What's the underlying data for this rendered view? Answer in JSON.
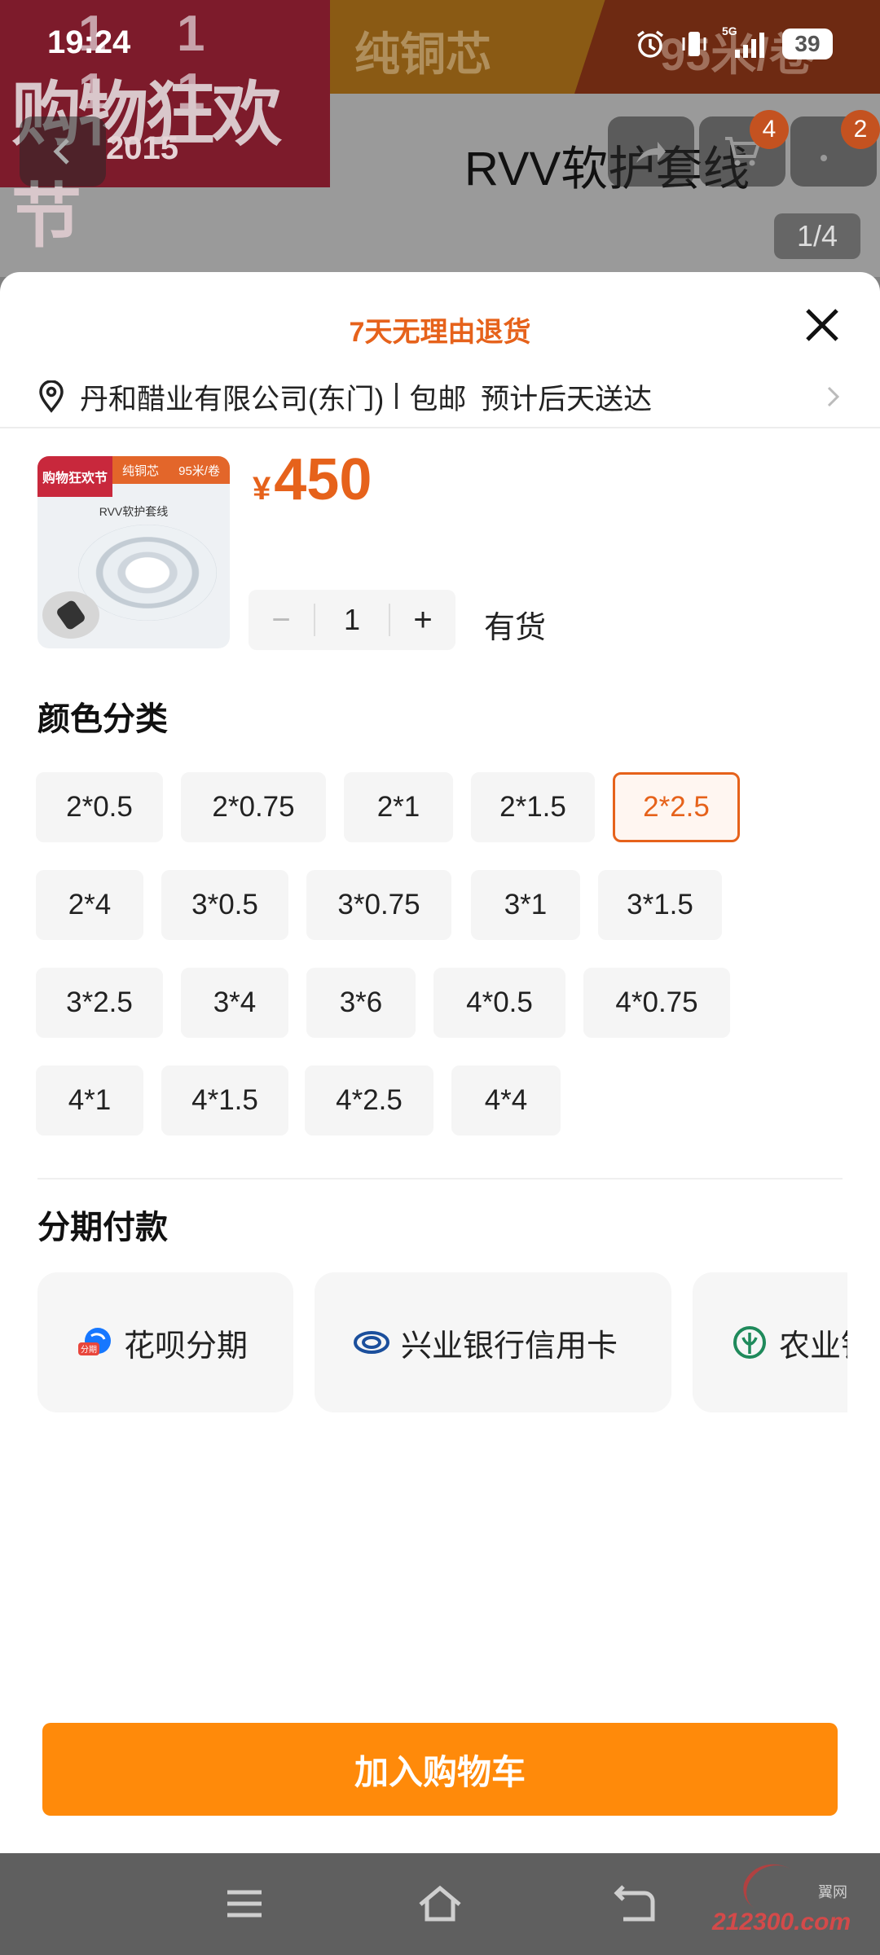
{
  "status_bar": {
    "time": "19:24",
    "network": "5G",
    "battery": "39"
  },
  "background_page": {
    "banner": {
      "festival_top": "11 11",
      "festival_name": "购物狂欢节",
      "festival_year": "2015",
      "copper_core": "纯铜芯",
      "spec": "95米/卷"
    },
    "title": "RVV软护套线",
    "cart_badge": "4",
    "message_badge": "2",
    "page_indicator": "1/4"
  },
  "sheet": {
    "return_policy": "7天无理由退货",
    "address": {
      "location": "丹和醋业有限公司(东门)",
      "shipping": "包邮",
      "delivery": "预计后天送达"
    },
    "product": {
      "thumb_festival": "购物狂欢节",
      "thumb_copper": "纯铜芯",
      "thumb_spec": "95米/卷",
      "thumb_label": "RVV软护套线",
      "currency": "¥",
      "price": "450",
      "quantity": "1",
      "minus": "−",
      "plus": "+",
      "stock": "有货"
    },
    "color_section": {
      "title": "颜色分类",
      "selected": "2*2.5",
      "options": [
        "2*0.5",
        "2*0.75",
        "2*1",
        "2*1.5",
        "2*2.5",
        "2*4",
        "3*0.5",
        "3*0.75",
        "3*1",
        "3*1.5",
        "3*2.5",
        "3*4",
        "3*6",
        "4*0.5",
        "4*0.75",
        "4*1",
        "4*1.5",
        "4*2.5",
        "4*4"
      ]
    },
    "installment": {
      "title": "分期付款",
      "options": [
        {
          "label": "花呗分期",
          "icon": "huabei-icon",
          "icon_text": "分期"
        },
        {
          "label": "兴业银行信用卡",
          "icon": "cib-bank-icon"
        },
        {
          "label": "农业银行信用卡",
          "icon": "abc-bank-icon"
        }
      ]
    },
    "add_to_cart": "加入购物车"
  },
  "watermark": {
    "site": "212300.com",
    "small": "翼网"
  },
  "colors": {
    "accent": "#e6621b",
    "cart_button": "#ff8a0a",
    "option_bg": "#f5f5f5"
  }
}
